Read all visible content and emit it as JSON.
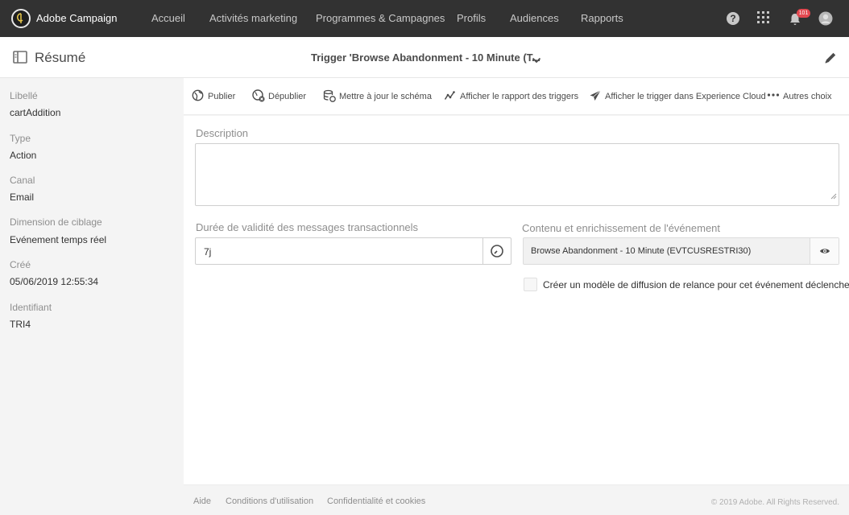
{
  "app": {
    "brand": "Adobe Campaign"
  },
  "nav": {
    "items": [
      {
        "label": "Accueil"
      },
      {
        "label": "Activités marketing"
      },
      {
        "label": "Programmes & Campagnes"
      },
      {
        "label": "Profils"
      },
      {
        "label": "Audiences"
      },
      {
        "label": "Rapports"
      }
    ],
    "notifications_count": "101"
  },
  "header": {
    "title": "Résumé",
    "trigger_title": "Trigger 'Browse Abandonment - 10 Minute (T..."
  },
  "sidebar": {
    "props": [
      {
        "label": "Libellé",
        "value": "cartAddition"
      },
      {
        "label": "Type",
        "value": "Action"
      },
      {
        "label": "Canal",
        "value": "Email"
      },
      {
        "label": "Dimension de ciblage",
        "value": "Evénement temps réel"
      },
      {
        "label": "Créé",
        "value": "05/06/2019 12:55:34"
      },
      {
        "label": "Identifiant",
        "value": "TRI4"
      }
    ]
  },
  "toolbar": {
    "publish": "Publier",
    "unpublish": "Dépublier",
    "update_schema": "Mettre à jour le schéma",
    "trigger_report": "Afficher le rapport des triggers",
    "experience_cloud": "Afficher le trigger dans Experience Cloud",
    "more": "Autres choix"
  },
  "form": {
    "description_label": "Description",
    "description_value": "",
    "validity_label": "Durée de validité des messages transactionnels",
    "validity_value": "7j",
    "event_label": "Contenu et enrichissement de l'événement",
    "event_value": "Browse Abandonment - 10 Minute (EVTCUSRESTRI30)",
    "relaunch_label": "Créer un modèle de diffusion de relance pour cet événement déclencheur",
    "relaunch_checked": false
  },
  "footer": {
    "help": "Aide",
    "terms": "Conditions d'utilisation",
    "privacy": "Confidentialité et cookies",
    "copyright": "© 2019 Adobe. All Rights Reserved."
  },
  "colors": {
    "topbar": "#323232",
    "sidebar": "#f4f4f4",
    "badge": "#e34850"
  }
}
